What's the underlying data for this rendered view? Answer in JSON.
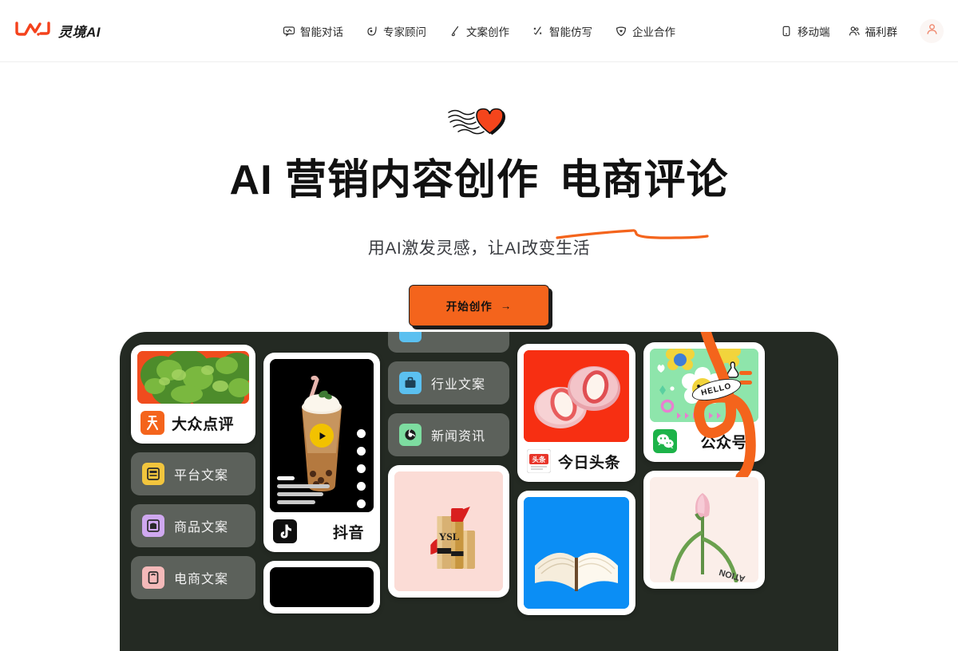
{
  "brand": {
    "name": "灵境AI",
    "logo_icon": "lingjing-wave-logo",
    "accent": "#f4641c"
  },
  "nav": {
    "items": [
      {
        "label": "智能对话",
        "icon": "chat-bubble-icon"
      },
      {
        "label": "专家顾问",
        "icon": "compass-icon"
      },
      {
        "label": "文案创作",
        "icon": "pen-nib-icon"
      },
      {
        "label": "智能仿写",
        "icon": "sparkle-pen-icon"
      },
      {
        "label": "企业合作",
        "icon": "shield-heart-icon"
      }
    ]
  },
  "header_right": {
    "items": [
      {
        "label": "移动端",
        "icon": "mobile-phone-icon"
      },
      {
        "label": "福利群",
        "icon": "user-group-icon"
      }
    ],
    "avatar_icon": "user-avatar-icon"
  },
  "hero": {
    "decoration_icon": "heart-with-motion-lines",
    "headline_part1": "AI 营销内容创作",
    "headline_part2": "电商评论",
    "underline_color": "#f4641c",
    "subtitle": "用AI激发灵感，让AI改变生活",
    "cta_label": "开始创作",
    "cta_arrow": "→",
    "cta_bg": "#f4641c"
  },
  "gallery": {
    "bg": "#242a23",
    "arrow_icon": "curved-orange-arrow",
    "hello_badge": "HELLO",
    "columns": [
      {
        "name": "column-1",
        "cards": [
          {
            "type": "platform",
            "label": "大众点评",
            "icon": "dianping-icon",
            "icon_bg": "#f4641c",
            "image": "green-foliage-photo"
          },
          {
            "type": "pill",
            "label": "平台文案",
            "icon": "platform-copy-icon",
            "icon_bg": "#f2c53d"
          },
          {
            "type": "pill",
            "label": "商品文案",
            "icon": "product-copy-icon",
            "icon_bg": "#cfa8f0"
          },
          {
            "type": "pill",
            "label": "电商文案",
            "icon": "ecommerce-copy-icon",
            "icon_bg": "#f4b9b9"
          }
        ]
      },
      {
        "name": "column-2",
        "cards": [
          {
            "type": "video",
            "label": "抖音",
            "icon": "douyin-icon",
            "icon_bg": "#0f0f0f",
            "image": "bubble-tea-photo",
            "play_icon": "play-triangle-icon"
          },
          {
            "type": "video-partial",
            "label": "",
            "icon": "",
            "image": "dark-video-thumb"
          }
        ]
      },
      {
        "name": "column-3",
        "cards": [
          {
            "type": "pill-partial",
            "label": "",
            "icon": "cut-off-blue-icon",
            "icon_bg": "#5bc0f0"
          },
          {
            "type": "pill",
            "label": "行业文案",
            "icon": "briefcase-icon",
            "icon_bg": "#5bc0f0"
          },
          {
            "type": "pill",
            "label": "新闻资讯",
            "icon": "globe-news-icon",
            "icon_bg": "#7ddca0"
          },
          {
            "type": "image",
            "image": "ysl-lipstick-photo",
            "image_bg": "#fbdcd6"
          }
        ]
      },
      {
        "name": "column-4",
        "cards": [
          {
            "type": "platform",
            "label": "今日头条",
            "icon": "toutiao-icon",
            "icon_bg": "#e8352a",
            "icon_text": "头条",
            "image": "strawberry-mochi-photo",
            "image_bg": "#f72f12"
          },
          {
            "type": "image",
            "image": "open-book-photo",
            "image_bg": "#0b8ef5"
          }
        ]
      },
      {
        "name": "column-5",
        "cards": [
          {
            "type": "platform",
            "label": "公众号",
            "icon": "wechat-icon",
            "icon_bg": "#1db349",
            "image": "smiley-flowers-illustration",
            "image_bg": "#8ee5ab"
          },
          {
            "type": "image",
            "image": "pink-tulip-photo",
            "image_bg": "#fbeee9",
            "caption": "ATION"
          }
        ]
      }
    ]
  }
}
